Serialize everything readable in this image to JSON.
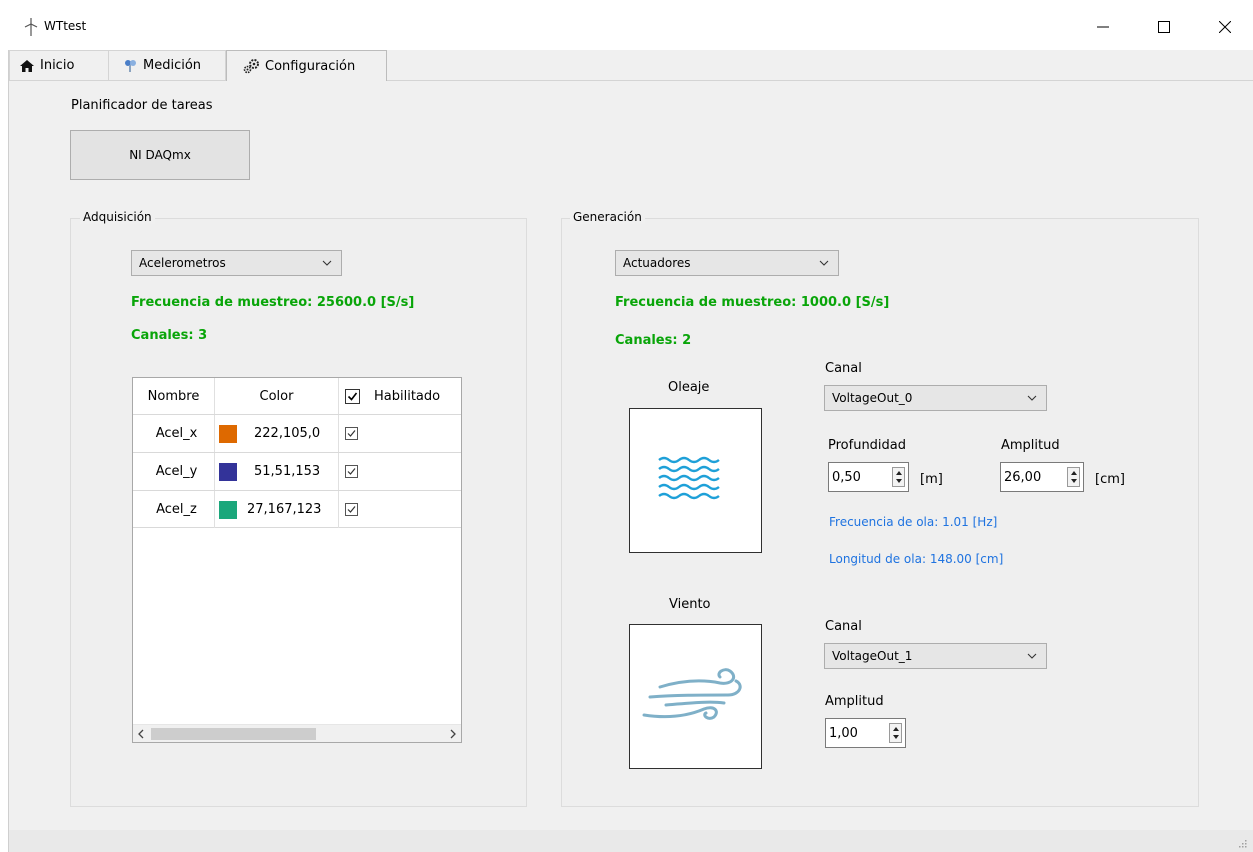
{
  "window": {
    "title": "WTtest"
  },
  "tabs": [
    {
      "label": "Inicio"
    },
    {
      "label": "Medición"
    },
    {
      "label": "Configuración"
    }
  ],
  "planner": {
    "title": "Planificador de tareas",
    "button_label": "NI DAQmx"
  },
  "acquisition": {
    "group_title": "Adquisición",
    "device": "Acelerometros",
    "sample_rate": "Frecuencia de muestreo: 25600.0 [S/s]",
    "channels": "Canales: 3",
    "table": {
      "headers": [
        "Nombre",
        "Color",
        "Habilitado"
      ],
      "rows": [
        {
          "name": "Acel_x",
          "color": "222,105,0",
          "swatch": "#de6900",
          "enabled": true
        },
        {
          "name": "Acel_y",
          "color": "51,51,153",
          "swatch": "#333399",
          "enabled": true
        },
        {
          "name": "Acel_z",
          "color": "27,167,123",
          "swatch": "#1ba77b",
          "enabled": true
        }
      ]
    }
  },
  "generation": {
    "group_title": "Generación",
    "device": "Actuadores",
    "sample_rate": "Frecuencia de muestreo: 1000.0 [S/s]",
    "channels": "Canales: 2",
    "waves": {
      "title": "Oleaje",
      "channel_label": "Canal",
      "channel": "VoltageOut_0",
      "depth_label": "Profundidad",
      "depth": "0,50",
      "depth_unit": "[m]",
      "amplitude_label": "Amplitud",
      "amplitude": "26,00",
      "amplitude_unit": "[cm]",
      "frequency": "Frecuencia de ola: 1.01 [Hz]",
      "wavelength": "Longitud de ola: 148.00 [cm]",
      "icon": "waves-icon"
    },
    "wind": {
      "title": "Viento",
      "channel_label": "Canal",
      "channel": "VoltageOut_1",
      "amplitude_label": "Amplitud",
      "amplitude": "1,00",
      "icon": "wind-icon"
    }
  },
  "colors": {
    "green_text": "#09a509",
    "blue_text": "#1f73e0",
    "waves": "#1ea0d8",
    "wind": "#7fb0c8"
  }
}
